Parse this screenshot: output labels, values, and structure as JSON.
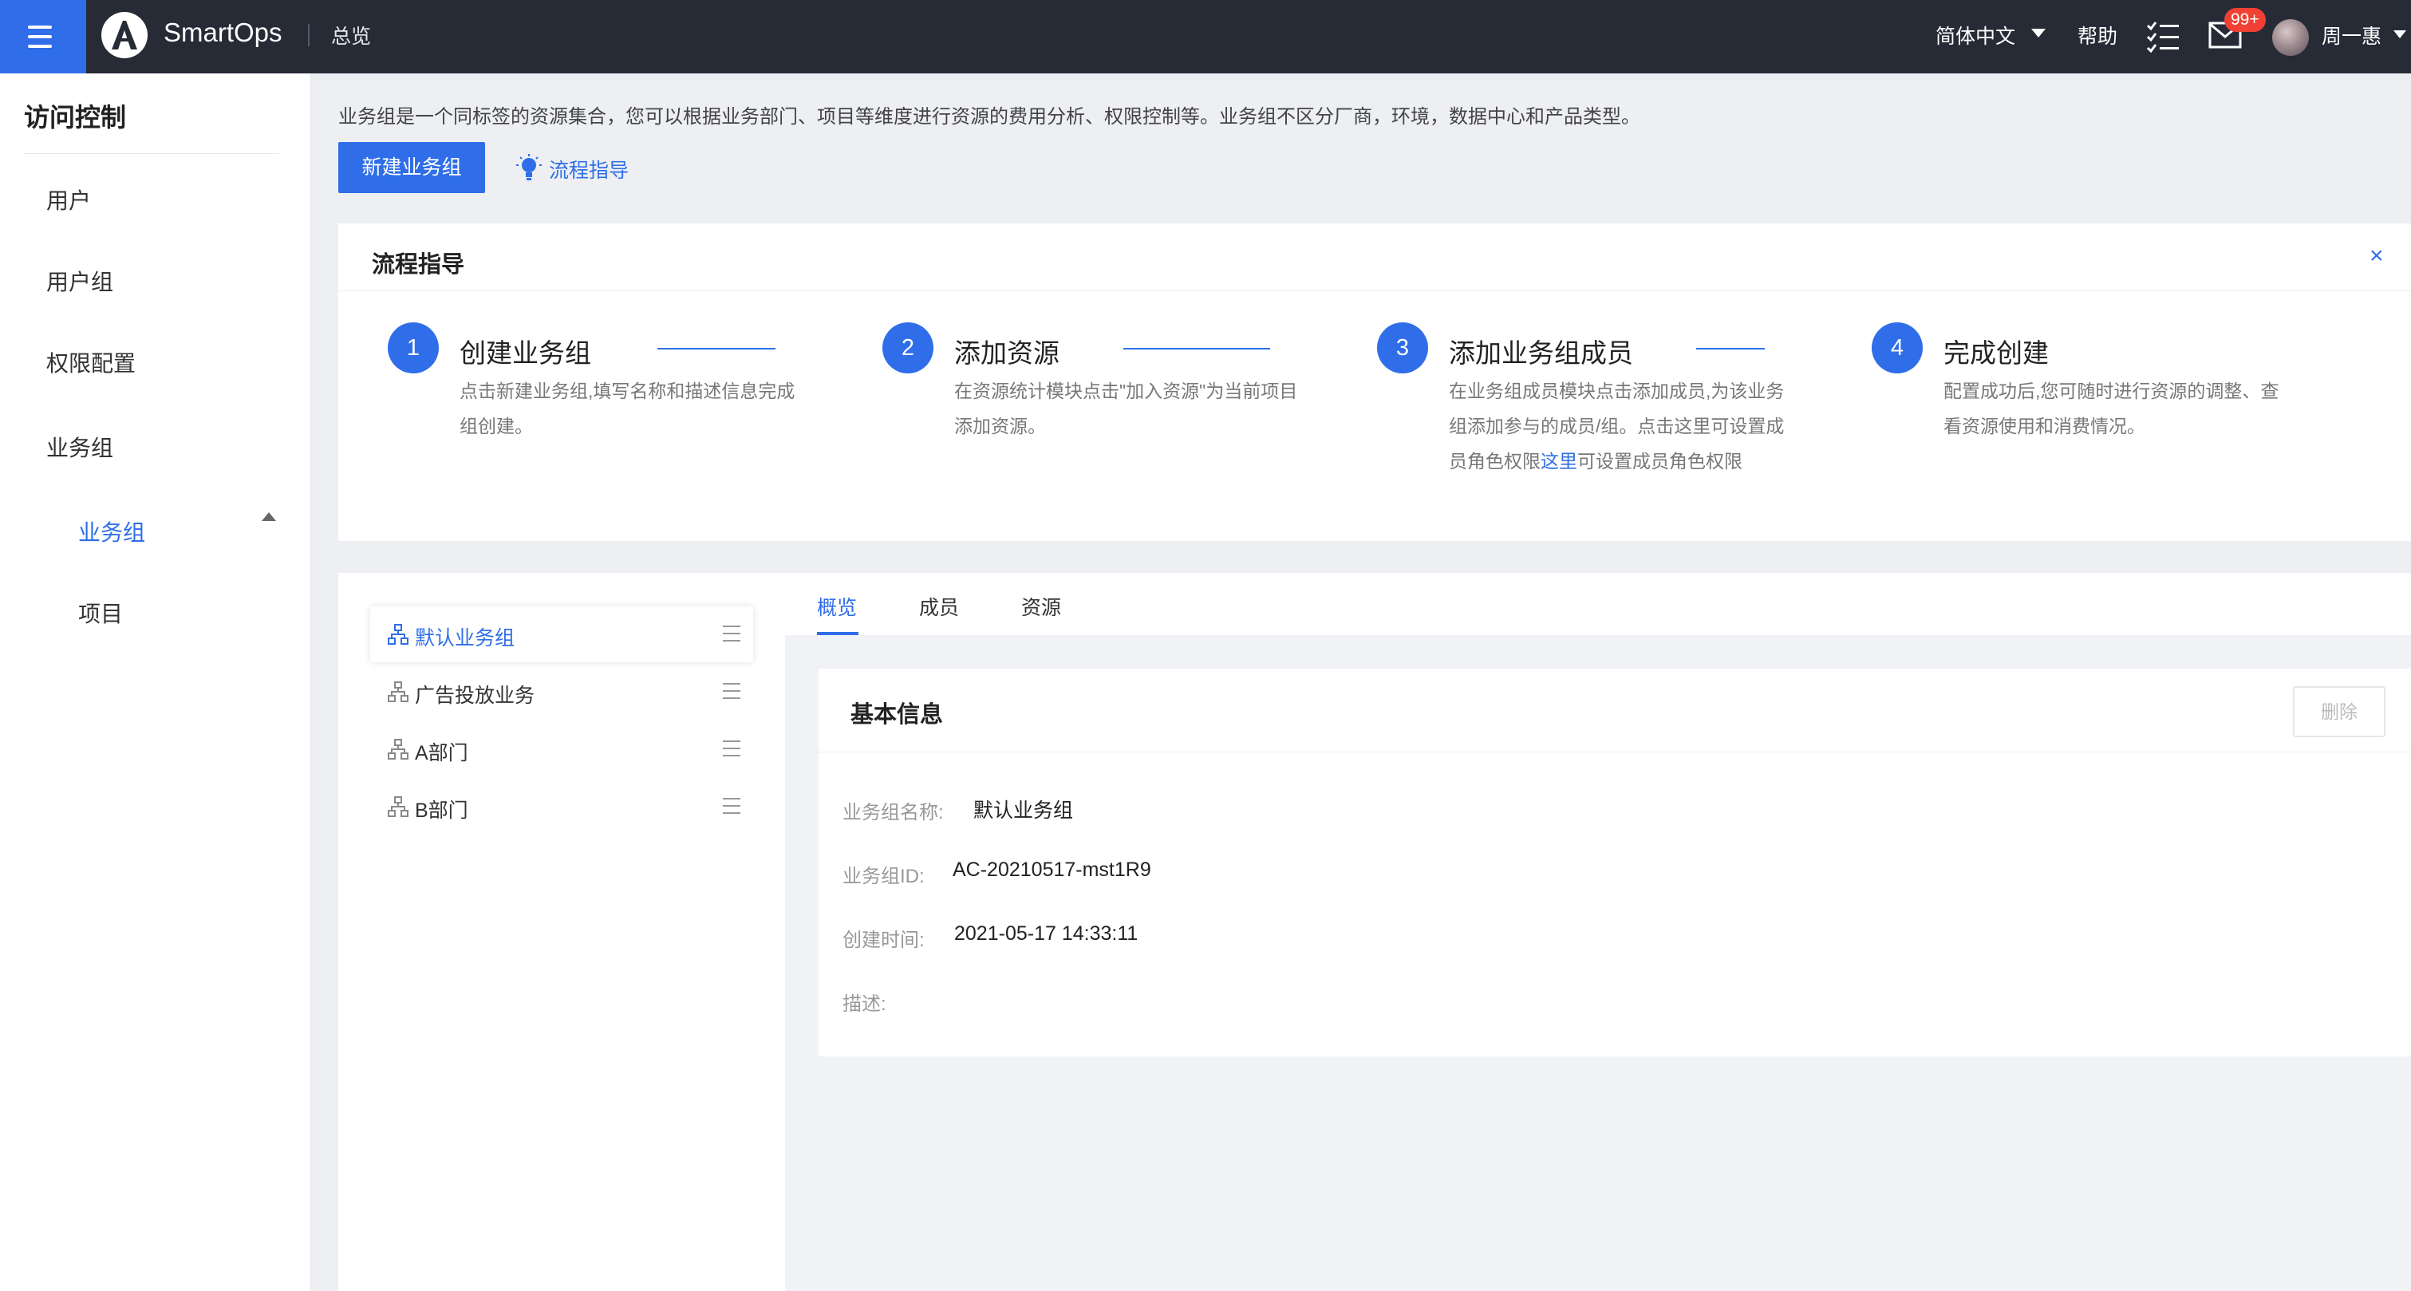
{
  "topbar": {
    "brand": "SmartOps",
    "breadcrumb": "总览",
    "language": "简体中文",
    "help": "帮助",
    "mail_badge": "99+",
    "username": "周一惠"
  },
  "sidebar": {
    "title": "访问控制",
    "items": [
      {
        "label": "用户"
      },
      {
        "label": "用户组"
      },
      {
        "label": "权限配置"
      },
      {
        "label": "业务组"
      }
    ],
    "subitems": [
      {
        "label": "业务组",
        "active": true
      },
      {
        "label": "项目"
      }
    ]
  },
  "main": {
    "description": "业务组是一个同标签的资源集合，您可以根据业务部门、项目等维度进行资源的费用分析、权限控制等。业务组不区分厂商，环境，数据中心和产品类型。",
    "new_button": "新建业务组",
    "guide_link": "流程指导"
  },
  "guide": {
    "title": "流程指导",
    "close": "×",
    "steps": [
      {
        "num": "1",
        "title": "创建业务组",
        "desc": "点击新建业务组,填写名称和描述信息完成组创建。"
      },
      {
        "num": "2",
        "title": "添加资源",
        "desc": "在资源统计模块点击\"加入资源\"为当前项目添加资源。"
      },
      {
        "num": "3",
        "title": "添加业务组成员",
        "desc_before": "在业务组成员模块点击添加成员,为该业务组添加参与的成员/组。点击这里可设置成员角色权限",
        "desc_link": "这里",
        "desc_after": "可设置成员角色权限"
      },
      {
        "num": "4",
        "title": "完成创建",
        "desc": "配置成功后,您可随时进行资源的调整、查看资源使用和消费情况。"
      }
    ]
  },
  "tree": {
    "items": [
      {
        "label": "默认业务组",
        "selected": true
      },
      {
        "label": "广告投放业务"
      },
      {
        "label": "A部门"
      },
      {
        "label": "B部门"
      }
    ]
  },
  "tabs": [
    {
      "label": "概览",
      "active": true
    },
    {
      "label": "成员"
    },
    {
      "label": "资源"
    }
  ],
  "info": {
    "title": "基本信息",
    "delete_button": "删除",
    "fields": [
      {
        "label": "业务组名称:",
        "value": "默认业务组"
      },
      {
        "label": "业务组ID:",
        "value": "AC-20210517-mst1R9"
      },
      {
        "label": "创建时间:",
        "value": "2021-05-17 14:33:11"
      },
      {
        "label": "描述:",
        "value": ""
      }
    ]
  },
  "colors": {
    "accent": "#2f6ee8",
    "topbar": "#262b36",
    "badge": "#f04134"
  }
}
